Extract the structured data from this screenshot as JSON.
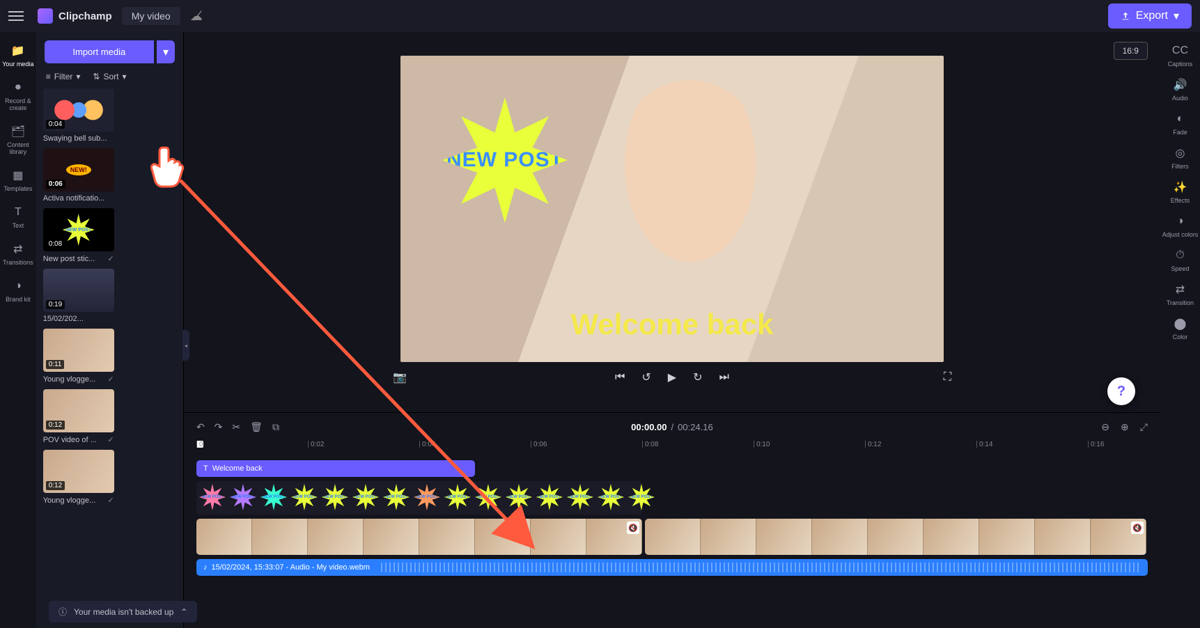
{
  "brand": "Clipchamp",
  "project_name": "My video",
  "export_label": "Export",
  "aspect_label": "16:9",
  "left_rail": [
    {
      "icon": "📁",
      "label": "Your media"
    },
    {
      "icon": "⏺",
      "label": "Record & create"
    },
    {
      "icon": "🗂",
      "label": "Content library"
    },
    {
      "icon": "▦",
      "label": "Templates"
    },
    {
      "icon": "T",
      "label": "Text"
    },
    {
      "icon": "⇄",
      "label": "Transitions"
    },
    {
      "icon": "◑",
      "label": "Brand kit"
    }
  ],
  "import_label": "Import media",
  "filter_label": "Filter",
  "sort_label": "Sort",
  "media": [
    {
      "name": "Swaying bell sub...",
      "dur": "0:04",
      "cls": "thumb-bells",
      "ck": false
    },
    {
      "name": "Activa notificatio...",
      "dur": "0:06",
      "cls": "thumb-notif",
      "ck": false
    },
    {
      "name": "New post stic...",
      "dur": "0:08",
      "cls": "thumb-newpost",
      "ck": true
    },
    {
      "name": "15/02/202...",
      "dur": "0:19",
      "cls": "thumb-date",
      "ck": false
    },
    {
      "name": "Young vlogge...",
      "dur": "0:11",
      "cls": "thumb-vlog",
      "ck": true
    },
    {
      "name": "POV video of ...",
      "dur": "0:12",
      "cls": "thumb-vlog",
      "ck": true
    },
    {
      "name": "Young vlogge...",
      "dur": "0:12",
      "cls": "thumb-vlog",
      "ck": true
    }
  ],
  "overlay_burst_text": "NEW POST",
  "overlay_welcome": "Welcome back",
  "time_current": "00:00.00",
  "time_total": "00:24.16",
  "right_rail": [
    {
      "icon": "CC",
      "label": "Captions"
    },
    {
      "icon": "🔊",
      "label": "Audio"
    },
    {
      "icon": "◐",
      "label": "Fade"
    },
    {
      "icon": "◎",
      "label": "Filters"
    },
    {
      "icon": "✨",
      "label": "Effects"
    },
    {
      "icon": "◑",
      "label": "Adjust colors"
    },
    {
      "icon": "⏱",
      "label": "Speed"
    },
    {
      "icon": "⇄",
      "label": "Transition"
    },
    {
      "icon": "⬤",
      "label": "Color"
    }
  ],
  "ruler": [
    "0",
    "0:02",
    "0:04",
    "0:06",
    "0:08",
    "0:10",
    "0:12",
    "0:14",
    "0:16"
  ],
  "text_clip": "Welcome back",
  "audio_clip": "15/02/2024, 15:33:07 - Audio - My video.webm",
  "backup_msg": "Your media isn't backed up",
  "burst_mini": "NEW POST",
  "help": "?",
  "sticker_colors": [
    "#ff7aa8",
    "#b47aff",
    "#3affd0",
    "#e8ff3a",
    "#e8ff3a",
    "#e8ff3a",
    "#e8ff3a",
    "#ff9a5e",
    "#e8ff3a",
    "#e8ff3a",
    "#e8ff3a",
    "#e8ff3a",
    "#e8ff3a",
    "#e8ff3a",
    "#e8ff3a"
  ]
}
